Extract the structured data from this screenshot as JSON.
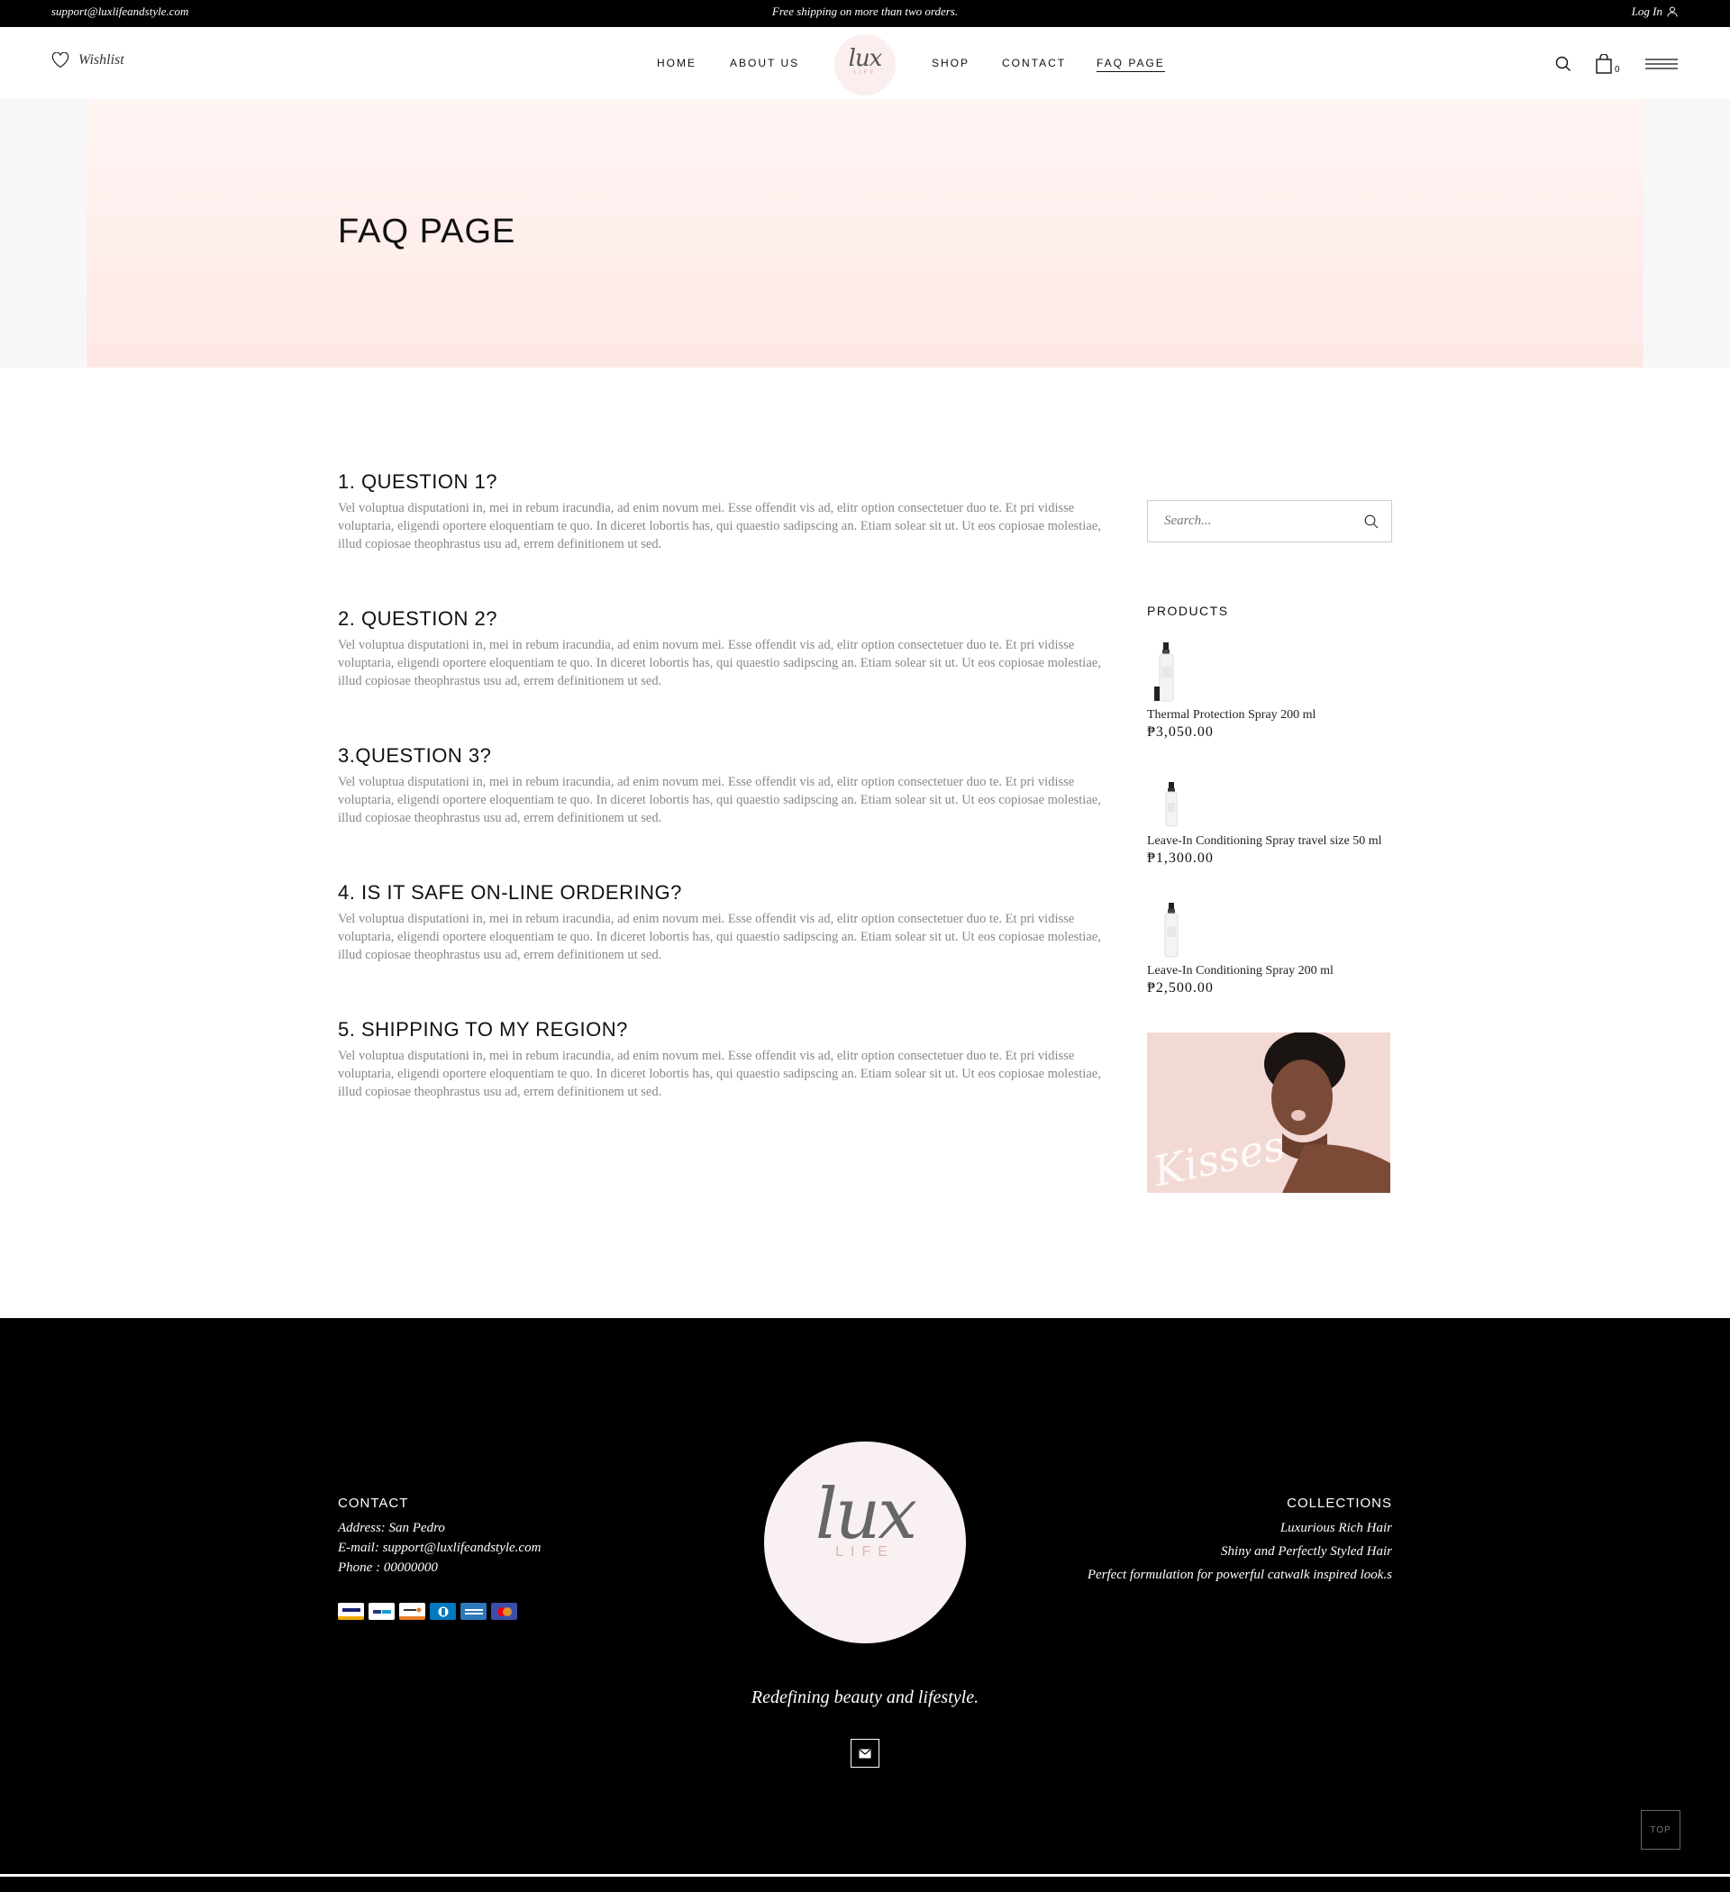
{
  "topbar": {
    "email": "support@luxlifeandstyle.com",
    "shipping": "Free shipping on more than two orders.",
    "login": "Log In"
  },
  "header": {
    "wishlist": "Wishlist",
    "nav": [
      "HOME",
      "ABOUT US",
      "SHOP",
      "CONTACT",
      "FAQ PAGE"
    ],
    "active_nav": "FAQ PAGE",
    "logo_script": "lux",
    "logo_word": "LIFE",
    "cart_count": "0"
  },
  "hero": {
    "title": "FAQ PAGE"
  },
  "faq": [
    {
      "question": "1. QUESTION 1?",
      "answer": "Vel voluptua disputationi in, mei in rebum iracundia, ad enim novum mei. Esse offendit vis ad, elitr option consectetuer duo te. Et pri vidisse voluptaria, eligendi oportere eloquentiam te quo. In diceret lobortis has, qui quaestio sadipscing an. Etiam solear sit ut. Ut eos copiosae molestiae, illud copiosae theophrastus usu ad, errem definitionem ut sed."
    },
    {
      "question": "2. QUESTION 2?",
      "answer": "Vel voluptua disputationi in, mei in rebum iracundia, ad enim novum mei. Esse offendit vis ad, elitr option consectetuer duo te. Et pri vidisse voluptaria, eligendi oportere eloquentiam te quo. In diceret lobortis has, qui quaestio sadipscing an. Etiam solear sit ut. Ut eos copiosae molestiae, illud copiosae theophrastus usu ad, errem definitionem ut sed."
    },
    {
      "question": "3.QUESTION 3?",
      "answer": "Vel voluptua disputationi in, mei in rebum iracundia, ad enim novum mei. Esse offendit vis ad, elitr option consectetuer duo te. Et pri vidisse voluptaria, eligendi oportere eloquentiam te quo. In diceret lobortis has, qui quaestio sadipscing an. Etiam solear sit ut. Ut eos copiosae molestiae, illud copiosae theophrastus usu ad, errem definitionem ut sed."
    },
    {
      "question": "4. IS IT SAFE ON-LINE ORDERING?",
      "answer": "Vel voluptua disputationi in, mei in rebum iracundia, ad enim novum mei. Esse offendit vis ad, elitr option consectetuer duo te. Et pri vidisse voluptaria, eligendi oportere eloquentiam te quo. In diceret lobortis has, qui quaestio sadipscing an. Etiam solear sit ut. Ut eos copiosae molestiae, illud copiosae theophrastus usu ad, errem definitionem ut sed."
    },
    {
      "question": "5. SHIPPING TO MY REGION?",
      "answer": "Vel voluptua disputationi in, mei in rebum iracundia, ad enim novum mei. Esse offendit vis ad, elitr option consectetuer duo te. Et pri vidisse voluptaria, eligendi oportere eloquentiam te quo. In diceret lobortis has, qui quaestio sadipscing an. Etiam solear sit ut. Ut eos copiosae molestiae, illud copiosae theophrastus usu ad, errem definitionem ut sed."
    }
  ],
  "sidebar": {
    "search_placeholder": "Search...",
    "products_title": "PRODUCTS",
    "products": [
      {
        "name": "Thermal Protection Spray 200 ml",
        "price": "₱3,050.00"
      },
      {
        "name": "Leave-In Conditioning Spray travel size 50 ml",
        "price": "₱1,300.00"
      },
      {
        "name": "Leave-In Conditioning Spray 200 ml",
        "price": "₱2,500.00"
      }
    ],
    "promo_script": "Kisses"
  },
  "footer": {
    "contact_title": "CONTACT",
    "address": "Address: San Pedro",
    "email": "E-mail: support@luxlifeandstyle.com",
    "phone": "Phone : 00000000",
    "payments": [
      "VISA",
      "PayPal",
      "DISCOVER",
      "Diners",
      "AMEX",
      "Mastercard"
    ],
    "collections_title": "COLLECTIONS",
    "collections": [
      "Luxurious Rich Hair",
      "Shiny and Perfectly Styled Hair",
      "Perfect formulation for powerful catwalk inspired look.s"
    ],
    "logo_script": "lux",
    "logo_word": "LIFE",
    "tagline": "Redefining beauty and lifestyle.",
    "top_label": "TOP"
  },
  "colors": {
    "hero_top": "#fff5f3",
    "hero_bottom": "#fee8e6",
    "footer_bg": "#000000",
    "body_text": "#888888"
  }
}
